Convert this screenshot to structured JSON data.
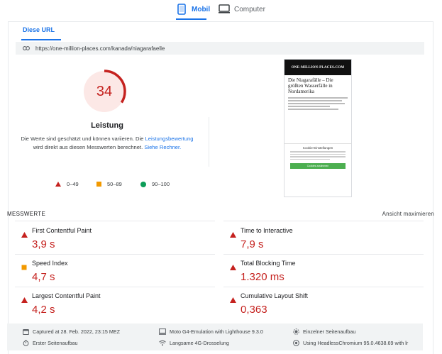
{
  "device_tabs": [
    {
      "label": "Mobil",
      "icon": "smartphone-icon",
      "active": true
    },
    {
      "label": "Computer",
      "icon": "monitor-icon",
      "active": false
    }
  ],
  "url_tab": "Diese URL",
  "url": "https://one-million-places.com/kanada/niagarafaelle",
  "score": {
    "value": "34",
    "fraction": 0.34,
    "color": "#c5221f"
  },
  "performance": {
    "title": "Leistung",
    "desc_part1": "Die Werte sind geschätzt und können variieren. Die ",
    "desc_link1": "Leistungsbewertung",
    "desc_part2": "wird direkt aus diesen Messwerten berechnet. ",
    "desc_link2": "Siehe Rechner."
  },
  "legend": [
    {
      "label": "0–49",
      "shape": "triangle",
      "color": "#c5221f"
    },
    {
      "label": "50–89",
      "shape": "square",
      "color": "#f29900"
    },
    {
      "label": "90–100",
      "shape": "circle",
      "color": "#0c9d58"
    }
  ],
  "preview": {
    "logo": "ONE-MILLION-PLACES.COM",
    "title": "Die Niagarafälle – Die größten Wasserfälle in Nordamerika",
    "cookie_title": "Cookie-Einstellungen",
    "cookie_button": "Cookies zustimmen"
  },
  "metrics_header": "MESSWERTE",
  "metrics_expand": "Ansicht maximieren",
  "metrics": [
    {
      "name": "First Contentful Paint",
      "value": "3,9 s",
      "status": "poor"
    },
    {
      "name": "Time to Interactive",
      "value": "7,9 s",
      "status": "poor"
    },
    {
      "name": "Speed Index",
      "value": "4,7 s",
      "status": "average"
    },
    {
      "name": "Total Blocking Time",
      "value": "1.320 ms",
      "status": "poor"
    },
    {
      "name": "Largest Contentful Paint",
      "value": "4,2 s",
      "status": "poor"
    },
    {
      "name": "Cumulative Layout Shift",
      "value": "0,363",
      "status": "poor"
    }
  ],
  "footer": [
    {
      "icon": "calendar-icon",
      "text": "Captured at 28. Feb. 2022, 23:15 MEZ"
    },
    {
      "icon": "device-icon",
      "text": "Moto G4-Emulation with Lighthouse 9.3.0"
    },
    {
      "icon": "pageload-icon",
      "text": "Einzelner Seitenaufbau"
    },
    {
      "icon": "stopwatch-icon",
      "text": "Erster Seitenaufbau"
    },
    {
      "icon": "wifi-icon",
      "text": "Langsame 4G-Drosselung"
    },
    {
      "icon": "browser-icon",
      "text": "Using HeadlessChromium 95.0.4638.69 with lr"
    }
  ]
}
